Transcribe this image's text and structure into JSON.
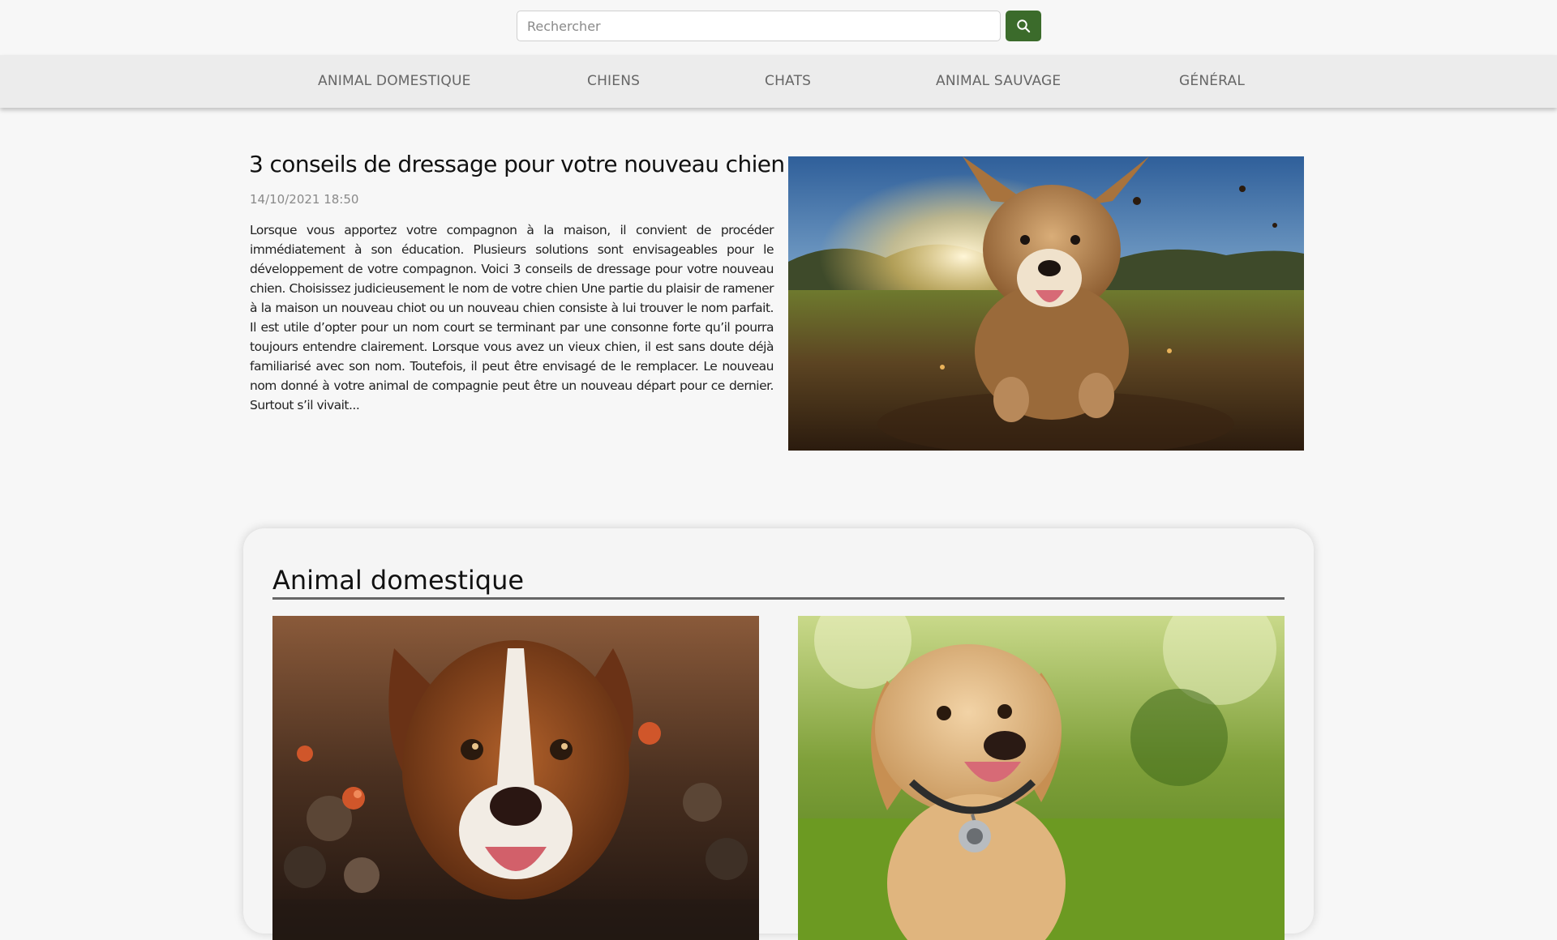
{
  "search": {
    "placeholder": "Rechercher",
    "value": ""
  },
  "icons": {
    "search": "search-icon"
  },
  "colors": {
    "accent": "#3b6b2b",
    "nav_background": "#ececec",
    "nav_text": "#666666",
    "page_background": "#f7f7f7"
  },
  "nav": {
    "items": [
      {
        "label": "ANIMAL DOMESTIQUE"
      },
      {
        "label": "CHIENS"
      },
      {
        "label": "CHATS"
      },
      {
        "label": "ANIMAL SAUVAGE"
      },
      {
        "label": "GÉNÉRAL"
      }
    ]
  },
  "featured": {
    "title": "3 conseils de dressage pour votre nouveau chien",
    "date": "14/10/2021 18:50",
    "excerpt": "  Lorsque vous apportez votre compagnon à la maison, il convient de procéder immédiatement à son éducation. Plusieurs solutions sont envisageables pour le développement de votre compagnon. Voici 3 conseils de dressage pour votre nouveau chien.  Choisissez judicieusement le nom de votre chien Une partie du plaisir de ramener à la maison un nouveau chiot ou un nouveau chien consiste à lui trouver le nom parfait. Il est utile d’opter pour un nom court se terminant par une consonne forte qu’il pourra toujours entendre clairement. Lorsque vous avez un vieux chien, il est sans doute déjà familiarisé avec son nom. Toutefois, il peut être envisagé de le remplacer. Le nouveau nom donné à votre animal de compagnie peut être un nouveau départ pour ce dernier. Surtout s’il vivait..."
  },
  "category": {
    "title": "Animal domestique"
  }
}
